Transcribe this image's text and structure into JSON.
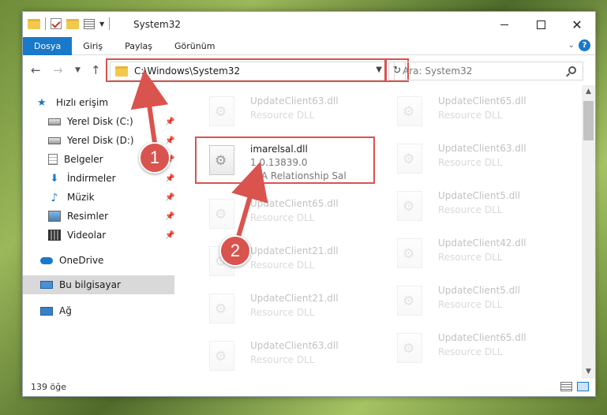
{
  "window": {
    "title": "System32",
    "minimize_label": "",
    "maximize_label": "",
    "close_label": "✕"
  },
  "ribbon": {
    "tabs": [
      {
        "label": "Dosya",
        "active": true
      },
      {
        "label": "Giriş"
      },
      {
        "label": "Paylaş"
      },
      {
        "label": "Görünüm"
      }
    ],
    "help": "?"
  },
  "address": {
    "path": "C:\\Windows\\System32",
    "search_placeholder": "Ara: System32"
  },
  "nav": {
    "items": [
      {
        "label": "Hızlı erişim",
        "icon": "star-icon"
      },
      {
        "label": "Yerel Disk (C:)",
        "icon": "disk-icon",
        "pinned": true
      },
      {
        "label": "Yerel Disk (D:)",
        "icon": "disk-icon",
        "pinned": true
      },
      {
        "label": "Belgeler",
        "icon": "document-icon",
        "pinned": true
      },
      {
        "label": "İndirmeler",
        "icon": "download-icon",
        "pinned": true
      },
      {
        "label": "Müzik",
        "icon": "music-icon",
        "pinned": true
      },
      {
        "label": "Resimler",
        "icon": "pictures-icon",
        "pinned": true
      },
      {
        "label": "Videolar",
        "icon": "videos-icon",
        "pinned": true
      },
      {
        "label": "OneDrive",
        "icon": "cloud-icon"
      },
      {
        "label": "Bu bilgisayar",
        "icon": "computer-icon",
        "selected": true
      },
      {
        "label": "Ağ",
        "icon": "network-icon"
      }
    ]
  },
  "files": {
    "left": [
      {
        "name": "UpdateClient63.dll",
        "type": "Resource DLL"
      },
      {
        "name": "imarelsal.dll",
        "version": "1.0.13839.0",
        "description": "IMA Relationship Sal",
        "highlighted": true
      },
      {
        "name": "UpdateClient65.dll",
        "type": "Resource DLL"
      },
      {
        "name": "UpdateClient21.dll",
        "type": "Resource DLL"
      },
      {
        "name": "UpdateClient21.dll",
        "type": "Resource DLL"
      },
      {
        "name": "UpdateClient63.dll",
        "type": "Resource DLL"
      }
    ],
    "right": [
      {
        "name": "UpdateClient65.dll",
        "type": "Resource DLL"
      },
      {
        "name": "UpdateClient63.dll",
        "type": "Resource DLL"
      },
      {
        "name": "UpdateClient5.dll",
        "type": "Resource DLL"
      },
      {
        "name": "UpdateClient42.dll",
        "type": "Resource DLL"
      },
      {
        "name": "UpdateClient5.dll",
        "type": "Resource DLL"
      },
      {
        "name": "UpdateClient65.dll",
        "type": "Resource DLL"
      }
    ]
  },
  "status": {
    "count": "139 öğe"
  },
  "callouts": [
    "1",
    "2"
  ],
  "colors": {
    "accent": "#1979ca",
    "highlight_red": "#d9534f"
  }
}
